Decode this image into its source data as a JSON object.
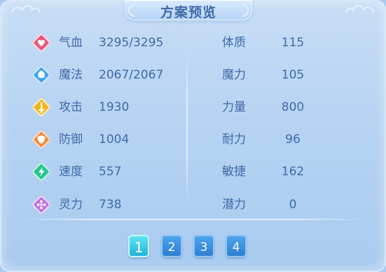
{
  "title": "方案预览",
  "left_stats": [
    {
      "label": "气血",
      "value": "3295/3295",
      "icon": "heart-icon",
      "color": "#e9577a"
    },
    {
      "label": "魔法",
      "value": "2067/2067",
      "icon": "mana-icon",
      "color": "#3fa4f0"
    },
    {
      "label": "攻击",
      "value": "1930",
      "icon": "sword-icon",
      "color": "#f2b51f"
    },
    {
      "label": "防御",
      "value": "1004",
      "icon": "shield-icon",
      "color": "#f18a3d"
    },
    {
      "label": "速度",
      "value": "557",
      "icon": "lightning-icon",
      "color": "#27c48e"
    },
    {
      "label": "灵力",
      "value": "738",
      "icon": "spirit-icon",
      "color": "#c06be0"
    }
  ],
  "right_stats": [
    {
      "label": "体质",
      "value": "115"
    },
    {
      "label": "魔力",
      "value": "105"
    },
    {
      "label": "力量",
      "value": "800"
    },
    {
      "label": "耐力",
      "value": "96"
    },
    {
      "label": "敏捷",
      "value": "162"
    },
    {
      "label": "潜力",
      "value": "0"
    }
  ],
  "pages": [
    "1",
    "2",
    "3",
    "4"
  ],
  "active_page": "1"
}
